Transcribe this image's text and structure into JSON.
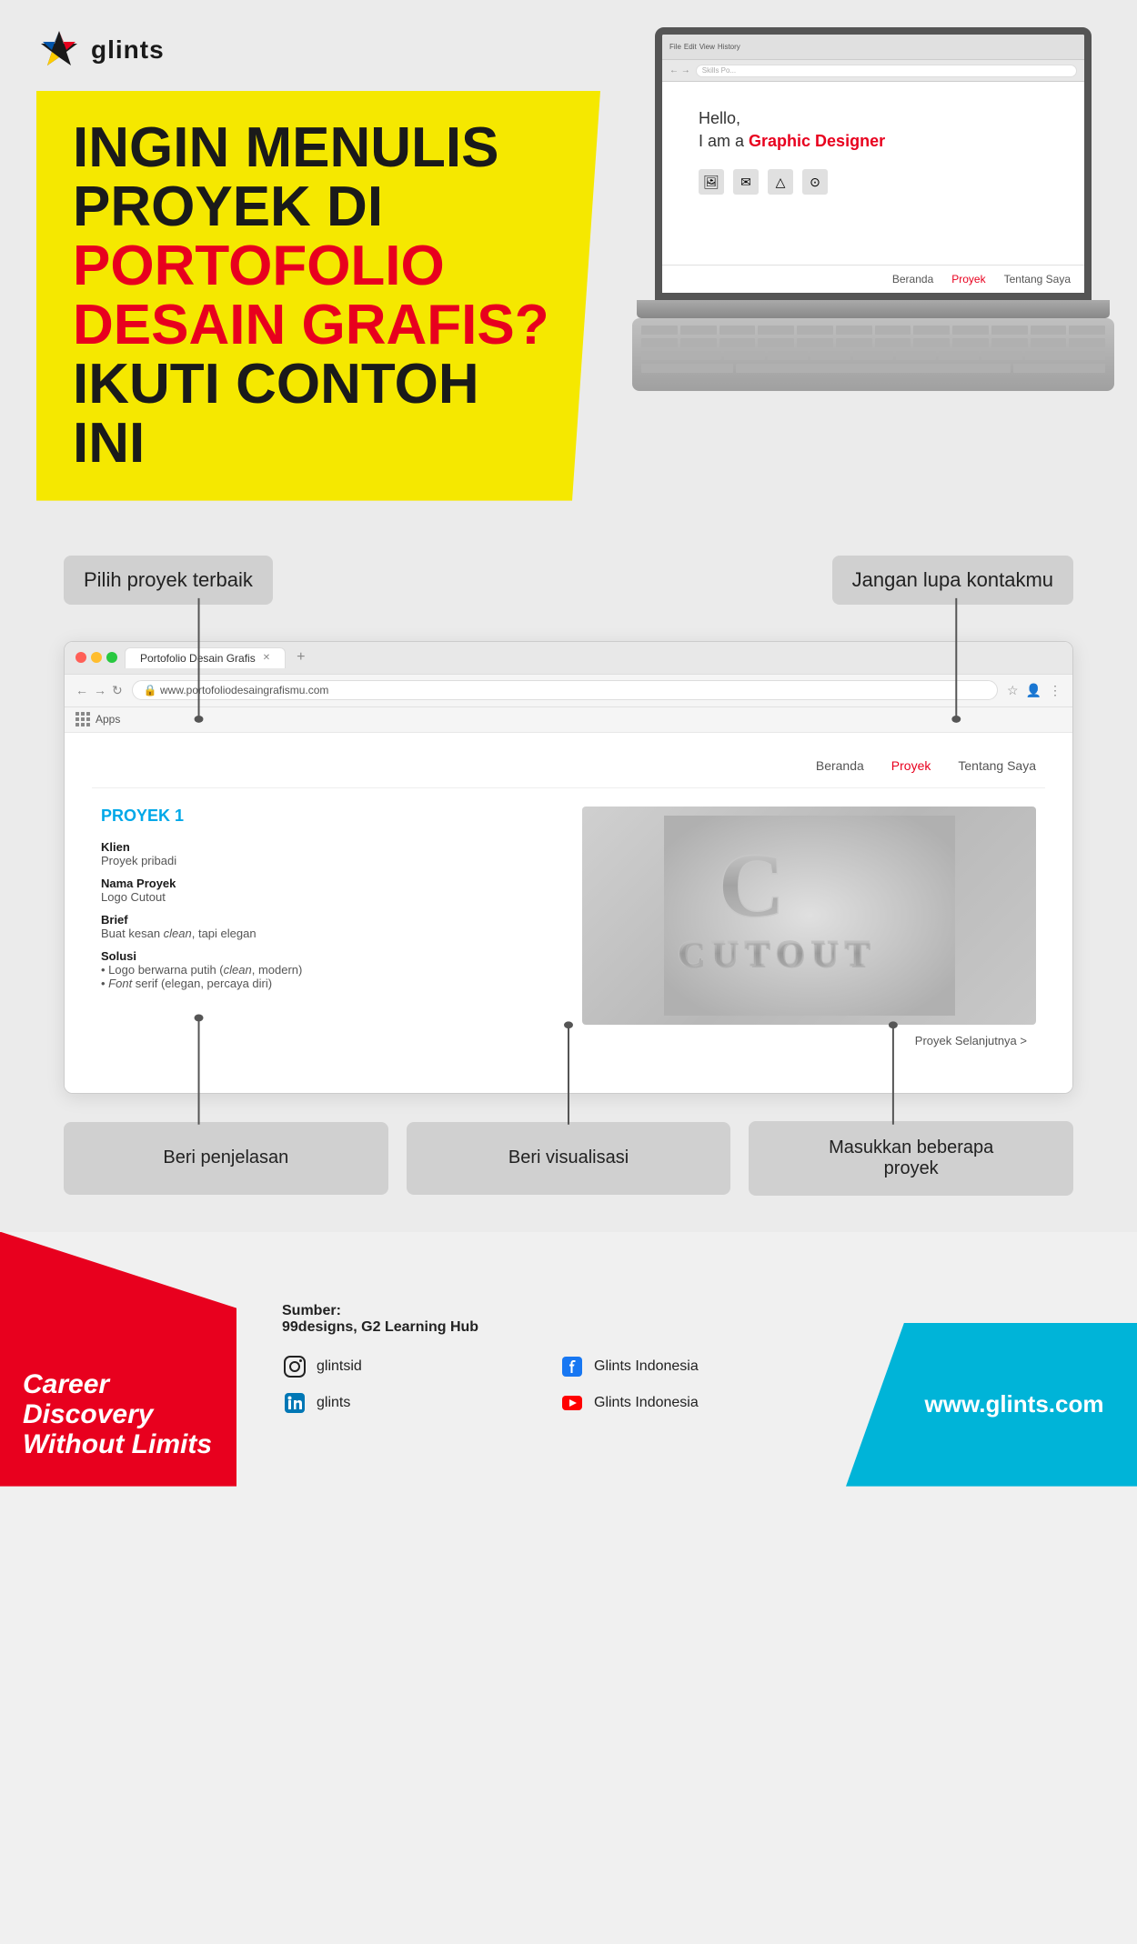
{
  "brand": {
    "name": "glints",
    "tagline": "Career Discovery Without Limits",
    "website": "www.glints.com"
  },
  "hero": {
    "line1": "INGIN MENULIS",
    "line2_black": "PROYEK DI ",
    "line2_red": "PORTOFOLIO",
    "line3_red": "DESAIN GRAFIS?",
    "line4": "IKUTI CONTOH INI"
  },
  "laptop": {
    "hello": "Hello,",
    "iam_prefix": "I am a ",
    "iam_role": "Graphic Designer",
    "nav_items": [
      "Beranda",
      "Proyek",
      "Tentang Saya"
    ]
  },
  "annotations": {
    "top_left": "Pilih proyek terbaik",
    "top_right": "Jangan lupa kontakmu",
    "bottom_1": "Beri penjelasan",
    "bottom_2": "Beri visualisasi",
    "bottom_3": "Masukkan beberapa\nproyek"
  },
  "browser": {
    "tab_label": "Portofolio Desain Grafis",
    "url": "www.portofoliodesaingrafismu.com",
    "bookmarks_label": "Apps",
    "nav_items": [
      "Beranda",
      "Proyek",
      "Tentang Saya"
    ],
    "active_nav": "Proyek"
  },
  "portfolio": {
    "project_title": "PROYEK 1",
    "fields": [
      {
        "label": "Klien",
        "value": "Proyek pribadi"
      },
      {
        "label": "Nama Proyek",
        "value": "Logo Cutout"
      },
      {
        "label": "Brief",
        "value": "Buat kesan clean, tapi elegan"
      },
      {
        "label": "Solusi",
        "value_lines": [
          "• Logo berwarna putih (clean, modern)",
          "• Font serif (elegan, percaya diri)"
        ]
      }
    ],
    "next_project": "Proyek Selanjutnya >"
  },
  "footer": {
    "source_label": "Sumber:",
    "source_value": "99designs, G2 Learning Hub",
    "social": [
      {
        "platform": "instagram",
        "handle": "glintsid",
        "icon": "📷"
      },
      {
        "platform": "facebook",
        "name": "Glints Indonesia",
        "icon": "f"
      },
      {
        "platform": "linkedin",
        "handle": "glints",
        "icon": "in"
      },
      {
        "platform": "youtube",
        "name": "Glints Indonesia",
        "icon": "▶"
      }
    ]
  }
}
